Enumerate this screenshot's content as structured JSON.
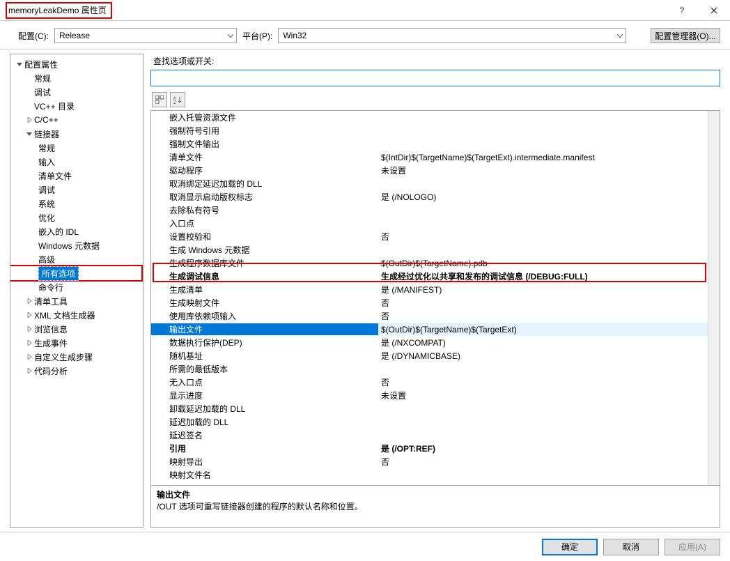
{
  "title": "memoryLeakDemo 属性页",
  "help_icon": "?",
  "config": {
    "label": "配置(C):",
    "value": "Release",
    "platform_label": "平台(P):",
    "platform_value": "Win32",
    "manager": "配置管理器(O)..."
  },
  "tree": [
    {
      "label": "配置属性",
      "depth": 0,
      "caret": "down"
    },
    {
      "label": "常规",
      "depth": 1
    },
    {
      "label": "调试",
      "depth": 1
    },
    {
      "label": "VC++ 目录",
      "depth": 1
    },
    {
      "label": "C/C++",
      "depth": 1,
      "caret": "right"
    },
    {
      "label": "链接器",
      "depth": 1,
      "caret": "down"
    },
    {
      "label": "常规",
      "depth": 2
    },
    {
      "label": "输入",
      "depth": 2
    },
    {
      "label": "清单文件",
      "depth": 2
    },
    {
      "label": "调试",
      "depth": 2
    },
    {
      "label": "系统",
      "depth": 2
    },
    {
      "label": "优化",
      "depth": 2
    },
    {
      "label": "嵌入的 IDL",
      "depth": 2
    },
    {
      "label": "Windows 元数据",
      "depth": 2
    },
    {
      "label": "高级",
      "depth": 2
    },
    {
      "label": "所有选项",
      "depth": 2,
      "selected": true
    },
    {
      "label": "命令行",
      "depth": 2
    },
    {
      "label": "清单工具",
      "depth": 1,
      "caret": "right"
    },
    {
      "label": "XML 文档生成器",
      "depth": 1,
      "caret": "right"
    },
    {
      "label": "浏览信息",
      "depth": 1,
      "caret": "right"
    },
    {
      "label": "生成事件",
      "depth": 1,
      "caret": "right"
    },
    {
      "label": "自定义生成步骤",
      "depth": 1,
      "caret": "right"
    },
    {
      "label": "代码分析",
      "depth": 1,
      "caret": "right"
    }
  ],
  "search_label": "查找选项或开关:",
  "props": [
    {
      "name": "嵌入托管资源文件",
      "val": ""
    },
    {
      "name": "强制符号引用",
      "val": ""
    },
    {
      "name": "强制文件输出",
      "val": ""
    },
    {
      "name": "清单文件",
      "val": "$(IntDir)$(TargetName)$(TargetExt).intermediate.manifest"
    },
    {
      "name": "驱动程序",
      "val": "未设置"
    },
    {
      "name": "取消绑定延迟加载的 DLL",
      "val": ""
    },
    {
      "name": "取消显示启动版权标志",
      "val": "是 (/NOLOGO)"
    },
    {
      "name": "去除私有符号",
      "val": ""
    },
    {
      "name": "入口点",
      "val": ""
    },
    {
      "name": "设置校验和",
      "val": "否"
    },
    {
      "name": "生成 Windows 元数据",
      "val": ""
    },
    {
      "name": "生成程序数据库文件",
      "val": "$(OutDir)$(TargetName).pdb"
    },
    {
      "name": "生成调试信息",
      "val": "生成经过优化以共享和发布的调试信息 (/DEBUG:FULL)",
      "bold": true,
      "highlight": true
    },
    {
      "name": "生成清单",
      "val": "是 (/MANIFEST)"
    },
    {
      "name": "生成映射文件",
      "val": "否"
    },
    {
      "name": "使用库依赖项输入",
      "val": "否"
    },
    {
      "name": "输出文件",
      "val": "$(OutDir)$(TargetName)$(TargetExt)",
      "sel": true
    },
    {
      "name": "数据执行保护(DEP)",
      "val": "是 (/NXCOMPAT)"
    },
    {
      "name": "随机基址",
      "val": "是 (/DYNAMICBASE)"
    },
    {
      "name": "所需的最低版本",
      "val": ""
    },
    {
      "name": "无入口点",
      "val": "否"
    },
    {
      "name": "显示进度",
      "val": "未设置"
    },
    {
      "name": "卸载延迟加载的 DLL",
      "val": ""
    },
    {
      "name": "延迟加载的 DLL",
      "val": ""
    },
    {
      "name": "延迟签名",
      "val": ""
    },
    {
      "name": "引用",
      "val": "是 (/OPT:REF)",
      "bold": true
    },
    {
      "name": "映射导出",
      "val": "否"
    },
    {
      "name": "映射文件名",
      "val": ""
    }
  ],
  "desc": {
    "title": "输出文件",
    "body": "/OUT 选项可重写链接器创建的程序的默认名称和位置。"
  },
  "buttons": {
    "ok": "确定",
    "cancel": "取消",
    "apply": "应用(A)"
  }
}
